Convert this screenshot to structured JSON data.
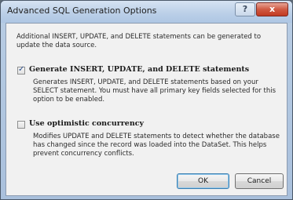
{
  "window": {
    "title": "Advanced SQL Generation Options",
    "help_label": "?",
    "close_label": "x"
  },
  "intro_text": "Additional INSERT, UPDATE, and DELETE statements can be generated to update the data source.",
  "options": [
    {
      "label": "Generate INSERT, UPDATE, and DELETE statements",
      "checked": true,
      "description": "Generates INSERT, UPDATE, and DELETE statements based on your SELECT statement. You must have all primary key fields selected for this option to be enabled."
    },
    {
      "label": "Use optimistic concurrency",
      "checked": false,
      "description": "Modifies UPDATE and DELETE statements to detect whether the database has changed since the record was loaded into the DataSet. This helps prevent concurrency conflicts."
    }
  ],
  "buttons": {
    "ok": "OK",
    "cancel": "Cancel"
  }
}
